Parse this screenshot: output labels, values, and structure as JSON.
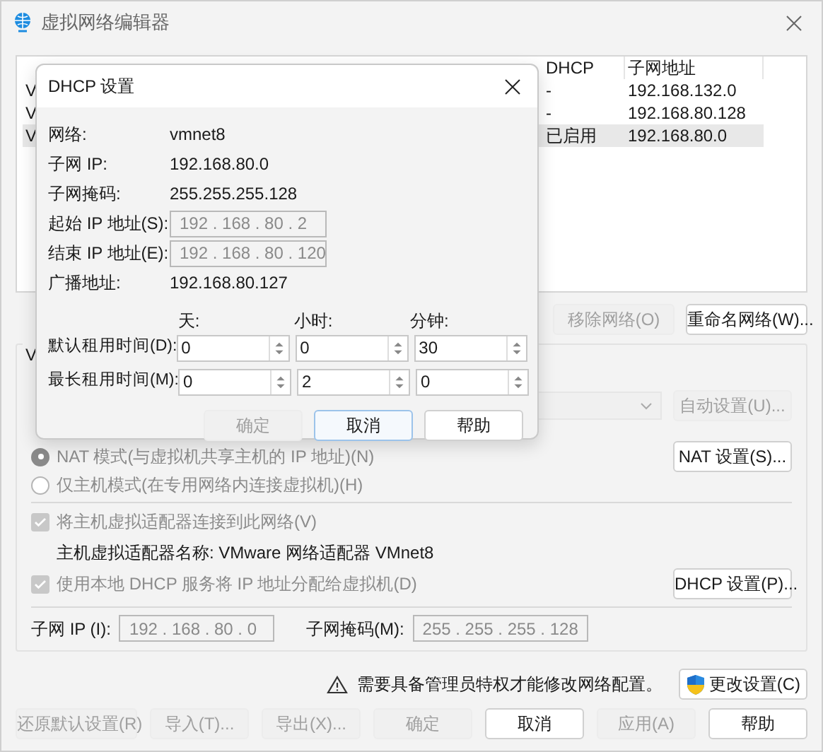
{
  "window": {
    "title": "虚拟网络编辑器"
  },
  "network_table": {
    "columns": [
      "DHCP",
      "子网地址"
    ],
    "rows": [
      {
        "name": "V",
        "dhcp": "-",
        "subnet": "192.168.132.0",
        "selected": false
      },
      {
        "name": "V",
        "dhcp": "-",
        "subnet": "192.168.80.128",
        "selected": false
      },
      {
        "name": "V",
        "dhcp": "已启用",
        "subnet": "192.168.80.0",
        "selected": true
      }
    ]
  },
  "network_buttons": [
    {
      "label": "移除网络(O)",
      "disabled": true
    },
    {
      "label": "重命名网络(W)...",
      "disabled": false
    }
  ],
  "vmnet_info": {
    "label": "V",
    "bridge_combo": {
      "disabled": true
    },
    "auto_button": {
      "label": "自动设置(U)...",
      "disabled": true
    },
    "modes": [
      {
        "label": "NAT 模式(与虚拟机共享主机的 IP 地址)(N)",
        "selected": true,
        "disabled": true
      },
      {
        "label": "仅主机模式(在专用网络内连接虚拟机)(H)",
        "selected": false,
        "disabled": true
      }
    ],
    "nat_button": {
      "label": "NAT 设置(S)...",
      "disabled": false
    },
    "connect_adapter": {
      "label": "将主机虚拟适配器连接到此网络(V)",
      "checked": true,
      "disabled": true
    },
    "adapter_name": "主机虚拟适配器名称: VMware 网络适配器 VMnet8",
    "use_dhcp": {
      "label": "使用本地 DHCP 服务将 IP 地址分配给虚拟机(D)",
      "checked": true,
      "disabled": true
    },
    "dhcp_button": {
      "label": "DHCP 设置(P)...",
      "disabled": false
    },
    "subnet_ip": {
      "label": "子网 IP (I):",
      "value": "192 . 168 . 80 . 0"
    },
    "subnet_mask": {
      "label": "子网掩码(M):",
      "value": "255 . 255 . 255 . 128"
    }
  },
  "warning": {
    "text": "需要具备管理员特权才能修改网络配置。"
  },
  "change_button": {
    "label": "更改设置(C)"
  },
  "footer_buttons": [
    {
      "label": "还原默认设置(R)",
      "disabled": true
    },
    {
      "label": "导入(T)...",
      "disabled": true
    },
    {
      "label": "导出(X)...",
      "disabled": true
    },
    {
      "label": "确定",
      "disabled": true
    },
    {
      "label": "取消",
      "disabled": false
    },
    {
      "label": "应用(A)",
      "disabled": true
    },
    {
      "label": "帮助",
      "disabled": false
    }
  ],
  "dhcp_dialog": {
    "title": "DHCP 设置",
    "info": [
      {
        "kind": "text",
        "label": "网络:",
        "value": "vmnet8"
      },
      {
        "kind": "text",
        "label": "子网 IP:",
        "value": "192.168.80.0"
      },
      {
        "kind": "text",
        "label": "子网掩码:",
        "value": "255.255.255.128"
      },
      {
        "kind": "field",
        "label": "起始 IP 地址(S):",
        "value": "192 . 168 . 80 . 2"
      },
      {
        "kind": "field",
        "label": "结束 IP 地址(E):",
        "value": "192 . 168 . 80 . 120"
      },
      {
        "kind": "text",
        "label": "广播地址:",
        "value": "192.168.80.127"
      }
    ],
    "lease_headers": [
      "天:",
      "小时:",
      "分钟:"
    ],
    "leases": [
      {
        "label": "默认租用时间(D):",
        "values": [
          "0",
          "0",
          "30"
        ]
      },
      {
        "label": "最长租用时间(M):",
        "values": [
          "0",
          "2",
          "0"
        ]
      }
    ],
    "buttons": [
      {
        "label": "确定",
        "disabled": true,
        "focused": false
      },
      {
        "label": "取消",
        "disabled": false,
        "focused": true
      },
      {
        "label": "帮助",
        "disabled": false,
        "focused": false
      }
    ]
  }
}
